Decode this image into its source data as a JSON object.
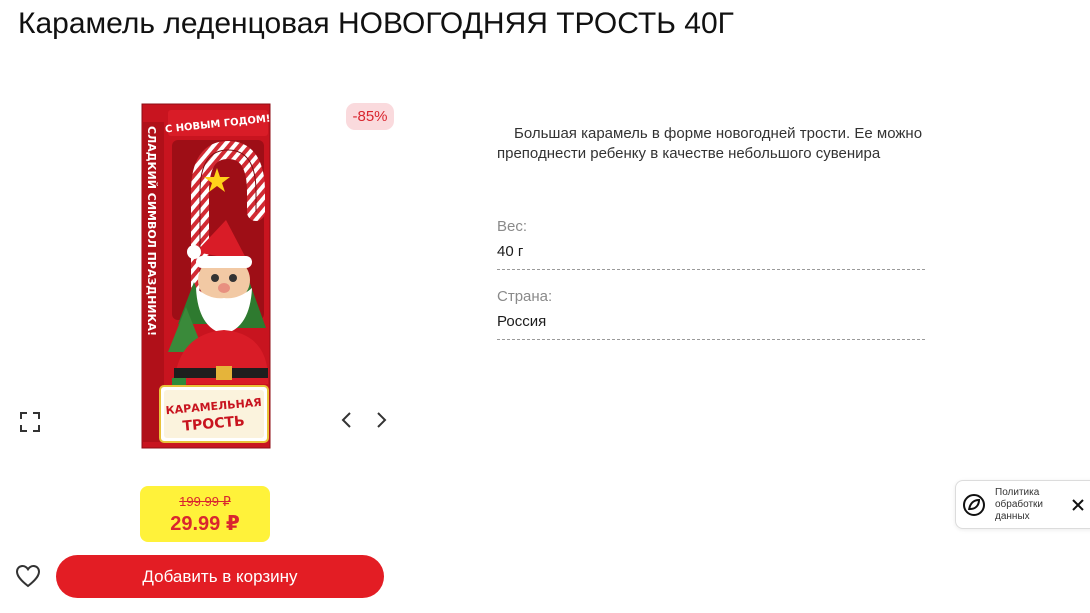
{
  "product": {
    "title": "Карамель леденцовая НОВОГОДНЯЯ ТРОСТЬ 40Г",
    "discount_badge": "-85%",
    "description": "Большая карамель в форме новогодней трости. Ее можно преподнести ребенку в качестве небольшого сувенира",
    "image": {
      "box_greeting": "С НОВЫМ ГОДОМ!",
      "box_slogan": "СЛАДКИЙ СИМВОЛ ПРАЗДНИКА!",
      "box_name_line1": "КАРАМЕЛЬНАЯ",
      "box_name_line2": "ТРОСТЬ"
    }
  },
  "price": {
    "old": "199.99 ₽",
    "current": "29.99 ₽"
  },
  "specs": [
    {
      "label": "Вес:",
      "value": "40 г"
    },
    {
      "label": "Страна:",
      "value": "Россия"
    }
  ],
  "actions": {
    "add_to_cart": "Добавить в корзину"
  },
  "policy_popup": {
    "text": "Политика обработки данных"
  },
  "icons": {
    "fullscreen": "fullscreen-icon",
    "prev": "chevron-left-icon",
    "next": "chevron-right-icon",
    "favorite": "heart-icon",
    "policy": "policy-leaf-icon",
    "close": "close-icon"
  },
  "colors": {
    "accent_red": "#e31d24",
    "price_red": "#d9262f",
    "price_bg": "#fff23a",
    "badge_bg": "#fadadd"
  }
}
